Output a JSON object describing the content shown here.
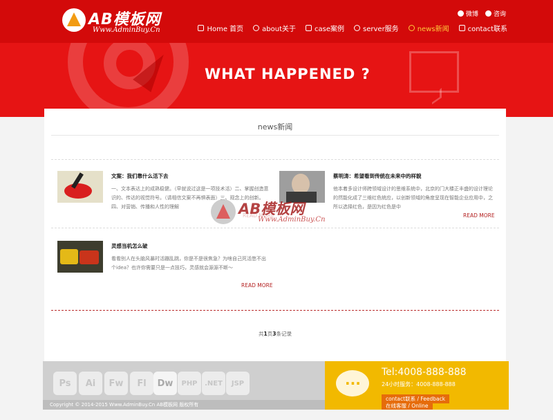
{
  "brand": {
    "logo_text": "AB模板网",
    "logo_sub": "Www.AdminBuy.Cn"
  },
  "toplinks": [
    {
      "label": "微博"
    },
    {
      "label": "咨询"
    }
  ],
  "nav": [
    {
      "label": "Home 首页",
      "icon": "home-icon"
    },
    {
      "label": "about关于",
      "icon": "info-icon"
    },
    {
      "label": "case案例",
      "icon": "link-icon"
    },
    {
      "label": "server服务",
      "icon": "refresh-icon"
    },
    {
      "label": "news新闻",
      "icon": "search-icon",
      "active": true
    },
    {
      "label": "contact联系",
      "icon": "mail-icon"
    }
  ],
  "banner": {
    "headline": "WHAT HAPPENED ?"
  },
  "panel": {
    "title": "news新闻"
  },
  "news": [
    {
      "title": "文案：我们靠什么活下去",
      "body": "一、文本表达上的成熟稳健。（早就说过这是一项技术活）二、掌握创造意识的、传达的视觉符号。（请相信文案不再惧表面）三、观念上的创新。四、对营销、传播和人性的理解",
      "more": "READ MORE"
    },
    {
      "title": "蔡明涛：希望看到传统在未来中的样貌",
      "body": "他本着多设计师跨领域设计的思维系统中，北京的门大楼正丰盛的设计理论的然能化成了三维红色统应，以创新领域的角度呈现在智能企业应用中，之所以选择红色，是因为红色是中",
      "more": "READ MORE"
    },
    {
      "title": "灵感当机怎么破",
      "body": "看看别人在头脑风暴时活蹦乱跳，你是不是很焦急？为啥自己死活憋不出个idea？也许你需要只是一点技巧，灵感就会源源不断～",
      "more": "READ MORE"
    }
  ],
  "watermark": {
    "brand": "AB模板网",
    "sub": "Www.AdminBuy.Cn"
  },
  "pager": {
    "prefix": "共",
    "pages": "1",
    "middle": "页",
    "count": "3",
    "suffix": "条记录"
  },
  "footer": {
    "tools": [
      "Ps",
      "Ai",
      "Fw",
      "Fl",
      "Dw",
      "PHP",
      ".NET",
      "JSP"
    ],
    "copyright": "Copyright © 2014-2015 Www.AdminBuy.Cn AB模板网 版权所有",
    "tel": "Tel:4008-888-888",
    "hotline": "24小时服务：4008-888-888",
    "feedback": "contact联系 / Feedback",
    "online": "在线客服 / Online"
  },
  "colors": {
    "header_red": "#d30a0a",
    "banner_red": "#e61414",
    "active_nav": "#ffcb3b",
    "footer_yellow": "#f2b900"
  }
}
